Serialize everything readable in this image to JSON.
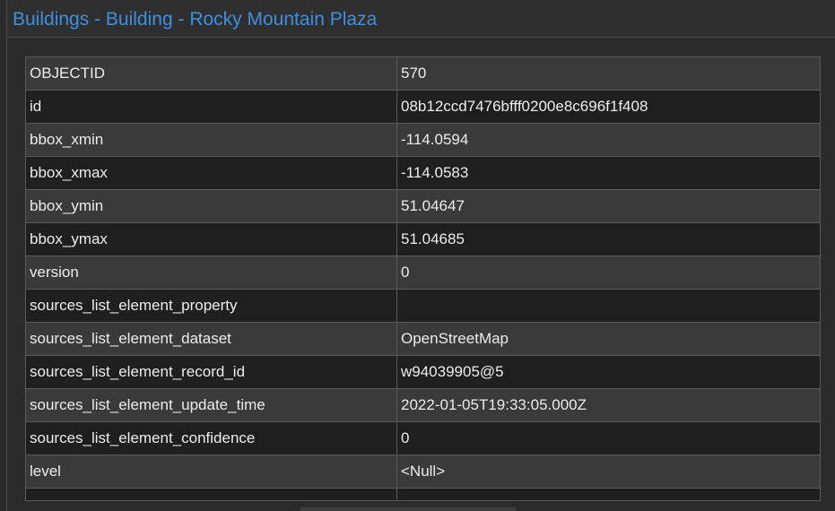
{
  "popup": {
    "title": {
      "layer": "Buildings",
      "separator": " - ",
      "subtype": "Building",
      "feature": "Rocky Mountain Plaza"
    },
    "accent_color": "#3d8fe0"
  },
  "attributes": [
    {
      "field": "OBJECTID",
      "value": "570"
    },
    {
      "field": "id",
      "value": "08b12ccd7476bfff0200e8c696f1f408"
    },
    {
      "field": "bbox_xmin",
      "value": "-114.0594"
    },
    {
      "field": "bbox_xmax",
      "value": "-114.0583"
    },
    {
      "field": "bbox_ymin",
      "value": "51.04647"
    },
    {
      "field": "bbox_ymax",
      "value": "51.04685"
    },
    {
      "field": "version",
      "value": "0"
    },
    {
      "field": "sources_list_element_property",
      "value": ""
    },
    {
      "field": "sources_list_element_dataset",
      "value": "OpenStreetMap"
    },
    {
      "field": "sources_list_element_record_id",
      "value": "w94039905@5"
    },
    {
      "field": "sources_list_element_update_time",
      "value": "2022-01-05T19:33:05.000Z"
    },
    {
      "field": "sources_list_element_confidence",
      "value": "0"
    },
    {
      "field": "level",
      "value": "<Null>"
    }
  ]
}
